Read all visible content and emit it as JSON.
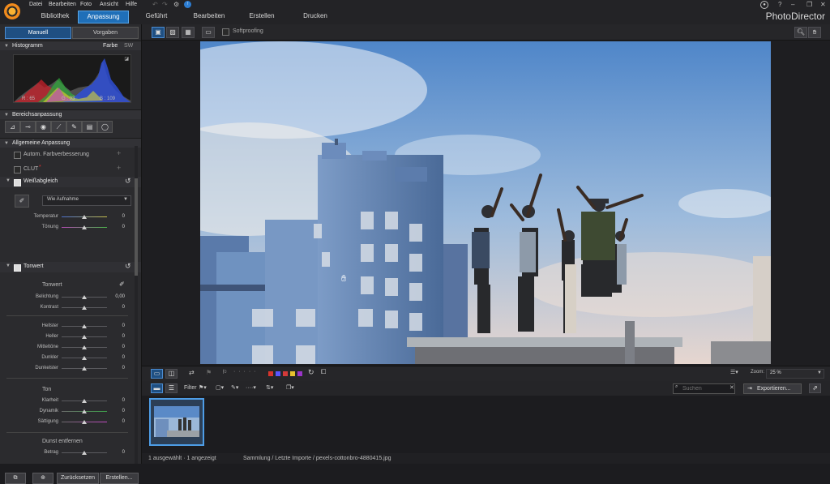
{
  "app": {
    "brand": "PhotoDirector",
    "menu": [
      "Datei",
      "Bearbeiten",
      "Foto",
      "Ansicht",
      "Hilfe"
    ],
    "nav_tabs": [
      "Bibliothek",
      "Anpassung",
      "Geführt",
      "Bearbeiten",
      "Erstellen",
      "Drucken"
    ],
    "active_nav": "Anpassung",
    "window_buttons": [
      "?",
      "–",
      "❐",
      "✕"
    ]
  },
  "left": {
    "tabs": [
      "Manuell",
      "Vorgaben"
    ],
    "histogram": {
      "title": "Histogramm",
      "modes": [
        "Farbe",
        "SW"
      ],
      "r": "R : 65",
      "g": "G : 93",
      "b": "B : 109"
    },
    "bereich": {
      "title": "Bereichsanpassung"
    },
    "allgemein": {
      "title": "Allgemeine Anpassung",
      "auto_label": "Autom. Farbverbesserung",
      "clut_label": "CLUT",
      "clut_mark": "*"
    },
    "weissabgleich": {
      "title": "Weißabgleich",
      "dropdown": "Wie Aufnahme",
      "sliders": [
        {
          "label": "Temperatur",
          "value": "0"
        },
        {
          "label": "Tönung",
          "value": "0"
        }
      ]
    },
    "tonwert": {
      "title": "Tonwert",
      "sub1": "Tonwert",
      "sliders1": [
        {
          "label": "Belichtung",
          "value": "0,00"
        },
        {
          "label": "Kontrast",
          "value": "0"
        }
      ],
      "sliders2": [
        {
          "label": "Hellster",
          "value": "0"
        },
        {
          "label": "Heller",
          "value": "0"
        },
        {
          "label": "Mitteltöne",
          "value": "0"
        },
        {
          "label": "Dunkler",
          "value": "0"
        },
        {
          "label": "Dunkelster",
          "value": "0"
        }
      ],
      "sub2": "Ton",
      "sliders3": [
        {
          "label": "Klarheit",
          "value": "0"
        },
        {
          "label": "Dynamik",
          "value": "0"
        },
        {
          "label": "Sättigung",
          "value": "0"
        }
      ],
      "sub3": "Dunst entfernen",
      "sliders4": [
        {
          "label": "Betrag",
          "value": "0"
        }
      ]
    },
    "bottom_buttons": [
      "Zurücksetzen",
      "Erstellen..."
    ]
  },
  "toolbar": {
    "softproofing": "Softproofing"
  },
  "filmtool": {
    "zoom_label": "Zoom:",
    "zoom_value": "25 %",
    "color_labels": [
      "#d8342c",
      "#e6c12e",
      "#2f9e3f",
      "#2f62d6",
      "#9a34c8"
    ]
  },
  "browser": {
    "filter_label": "Filter",
    "search_placeholder": "Suchen",
    "export_label": "Exportieren..."
  },
  "status": {
    "left": "1 ausgewählt · 1 angezeigt",
    "path": "Sammlung / Letzte Importe / pexels-cottonbro-4880415.jpg"
  }
}
